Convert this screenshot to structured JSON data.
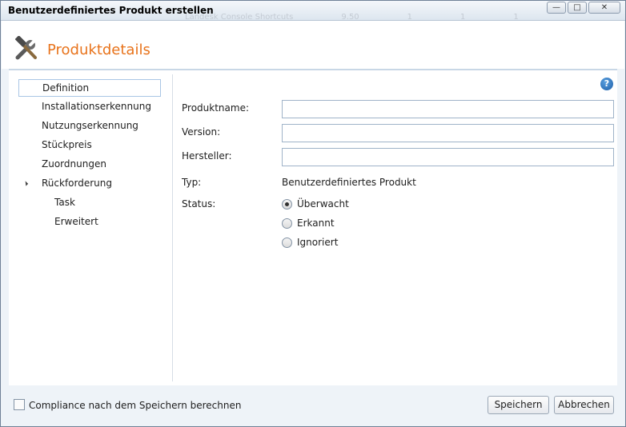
{
  "window": {
    "title": "Benutzerdefiniertes Produkt erstellen",
    "background_text": [
      "Landesk Console Shortcuts",
      "9.50",
      "1",
      "1",
      "1"
    ],
    "minimize_glyph": "—",
    "maximize_glyph": "□",
    "close_glyph": "✕"
  },
  "header": {
    "title": "Produktdetails",
    "icon": "tools-icon",
    "accent": "#e8731b"
  },
  "nav": {
    "items": [
      {
        "label": "Definition"
      },
      {
        "label": "Installationserkennung"
      },
      {
        "label": "Nutzungserkennung"
      },
      {
        "label": "Stückpreis"
      },
      {
        "label": "Zuordnungen"
      },
      {
        "label": "Rückforderung"
      },
      {
        "label": "Task"
      },
      {
        "label": "Erweitert"
      }
    ]
  },
  "help": {
    "glyph": "?"
  },
  "form": {
    "produktname": {
      "label": "Produktname:",
      "value": ""
    },
    "version": {
      "label": "Version:",
      "value": ""
    },
    "hersteller": {
      "label": "Hersteller:",
      "value": ""
    },
    "typ": {
      "label": "Typ:",
      "value": "Benutzerdefiniertes Produkt"
    },
    "status": {
      "label": "Status:",
      "options": [
        "Überwacht",
        "Erkannt",
        "Ignoriert"
      ],
      "selected": "Überwacht"
    }
  },
  "footer": {
    "compliance_label": "Compliance nach dem Speichern berechnen",
    "compliance_checked": false,
    "save_label": "Speichern",
    "cancel_label": "Abbrechen"
  }
}
